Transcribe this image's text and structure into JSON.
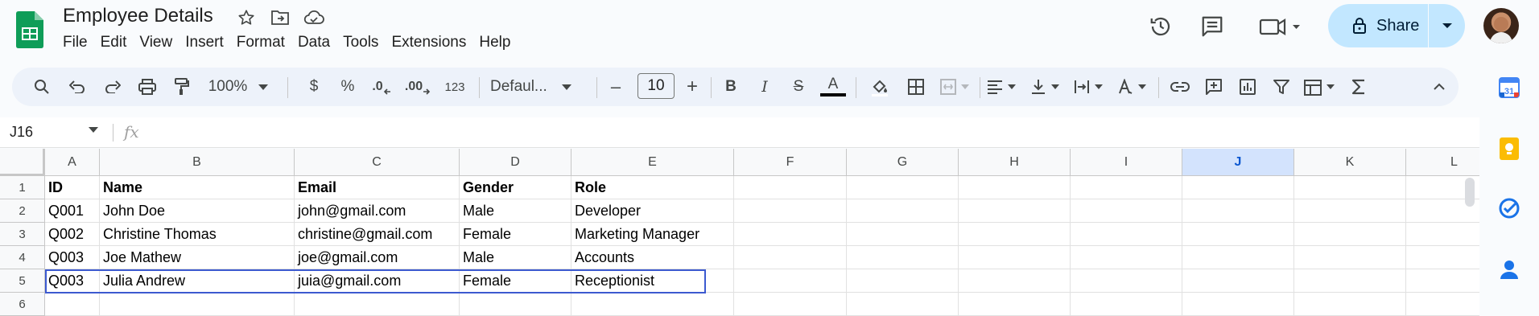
{
  "doc": {
    "title": "Employee Details",
    "icons": [
      "star-icon",
      "move-to-folder-icon",
      "cloud-saved-icon"
    ]
  },
  "menu": [
    "File",
    "Edit",
    "View",
    "Insert",
    "Format",
    "Data",
    "Tools",
    "Extensions",
    "Help"
  ],
  "header": {
    "share_label": "Share",
    "icons": [
      "version-history-icon",
      "comments-icon",
      "meet-icon"
    ]
  },
  "toolbar": {
    "zoom": "100%",
    "currency": "$",
    "percent": "%",
    "decrease_decimal": ".0",
    "increase_decimal": ".00",
    "number_format": "123",
    "font": "Defaul...",
    "font_size": "10",
    "minus": "–",
    "plus": "+",
    "bold": "B",
    "italic": "I",
    "strike": "S",
    "text_color": "A"
  },
  "formula": {
    "cell_ref": "J16",
    "fx": "fx"
  },
  "sheet": {
    "columns": [
      "A",
      "B",
      "C",
      "D",
      "E",
      "F",
      "G",
      "H",
      "I",
      "J",
      "K",
      "L"
    ],
    "selected_column": "J",
    "rows": [
      "1",
      "2",
      "3",
      "4",
      "5",
      "6"
    ],
    "cells": [
      [
        "ID",
        "Name",
        "Email",
        "Gender",
        "Role"
      ],
      [
        "Q001",
        "John Doe",
        "john@gmail.com",
        "Male",
        "Developer"
      ],
      [
        "Q002",
        "Christine Thomas",
        "christine@gmail.com",
        "Female",
        "Marketing Manager"
      ],
      [
        "Q003",
        "Joe Mathew",
        "joe@gmail.com",
        "Male",
        "Accounts"
      ],
      [
        "Q003",
        "Julia Andrew",
        "juia@gmail.com",
        "Female",
        "Receptionist"
      ],
      [
        "",
        "",
        "",
        "",
        ""
      ]
    ]
  },
  "side_panel": [
    "calendar-icon",
    "keep-icon",
    "tasks-icon",
    "contacts-icon"
  ],
  "colors": {
    "accent": "#0b57d0",
    "share_bg": "#c2e7ff",
    "selection": "#3c5ad0",
    "sheets_green": "#0f9d58"
  }
}
